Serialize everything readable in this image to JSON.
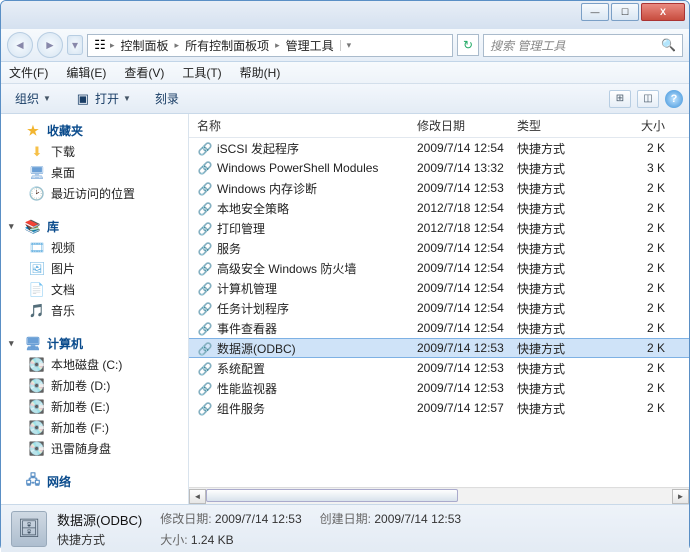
{
  "titlebar": {
    "min": "—",
    "max": "☐",
    "close": "X"
  },
  "nav": {
    "parts": [
      "控制面板",
      "所有控制面板项",
      "管理工具"
    ],
    "search_placeholder": "搜索 管理工具"
  },
  "menu": [
    "文件(F)",
    "编辑(E)",
    "查看(V)",
    "工具(T)",
    "帮助(H)"
  ],
  "toolbar": {
    "organize": "组织",
    "open": "打开",
    "burn": "刻录"
  },
  "sidebar": {
    "favorites": {
      "label": "收藏夹",
      "items": [
        "下载",
        "桌面",
        "最近访问的位置"
      ]
    },
    "libraries": {
      "label": "库",
      "items": [
        "视频",
        "图片",
        "文档",
        "音乐"
      ]
    },
    "computer": {
      "label": "计算机",
      "items": [
        "本地磁盘 (C:)",
        "新加卷 (D:)",
        "新加卷 (E:)",
        "新加卷 (F:)",
        "迅雷随身盘"
      ]
    },
    "network": {
      "label": "网络"
    }
  },
  "columns": {
    "name": "名称",
    "date": "修改日期",
    "type": "类型",
    "size": "大小"
  },
  "files": [
    {
      "name": "iSCSI 发起程序",
      "date": "2009/7/14 12:54",
      "type": "快捷方式",
      "size": "2 K"
    },
    {
      "name": "Windows PowerShell Modules",
      "date": "2009/7/14 13:32",
      "type": "快捷方式",
      "size": "3 K"
    },
    {
      "name": "Windows 内存诊断",
      "date": "2009/7/14 12:53",
      "type": "快捷方式",
      "size": "2 K"
    },
    {
      "name": "本地安全策略",
      "date": "2012/7/18 12:54",
      "type": "快捷方式",
      "size": "2 K"
    },
    {
      "name": "打印管理",
      "date": "2012/7/18 12:54",
      "type": "快捷方式",
      "size": "2 K"
    },
    {
      "name": "服务",
      "date": "2009/7/14 12:54",
      "type": "快捷方式",
      "size": "2 K"
    },
    {
      "name": "高级安全 Windows 防火墙",
      "date": "2009/7/14 12:54",
      "type": "快捷方式",
      "size": "2 K"
    },
    {
      "name": "计算机管理",
      "date": "2009/7/14 12:54",
      "type": "快捷方式",
      "size": "2 K"
    },
    {
      "name": "任务计划程序",
      "date": "2009/7/14 12:54",
      "type": "快捷方式",
      "size": "2 K"
    },
    {
      "name": "事件查看器",
      "date": "2009/7/14 12:54",
      "type": "快捷方式",
      "size": "2 K"
    },
    {
      "name": "数据源(ODBC)",
      "date": "2009/7/14 12:53",
      "type": "快捷方式",
      "size": "2 K",
      "selected": true
    },
    {
      "name": "系统配置",
      "date": "2009/7/14 12:53",
      "type": "快捷方式",
      "size": "2 K"
    },
    {
      "name": "性能监视器",
      "date": "2009/7/14 12:53",
      "type": "快捷方式",
      "size": "2 K"
    },
    {
      "name": "组件服务",
      "date": "2009/7/14 12:57",
      "type": "快捷方式",
      "size": "2 K"
    }
  ],
  "details": {
    "title": "数据源(ODBC)",
    "subtitle": "快捷方式",
    "mod_label": "修改日期:",
    "mod_value": "2009/7/14 12:53",
    "size_label": "大小:",
    "size_value": "1.24 KB",
    "create_label": "创建日期:",
    "create_value": "2009/7/14 12:53"
  }
}
